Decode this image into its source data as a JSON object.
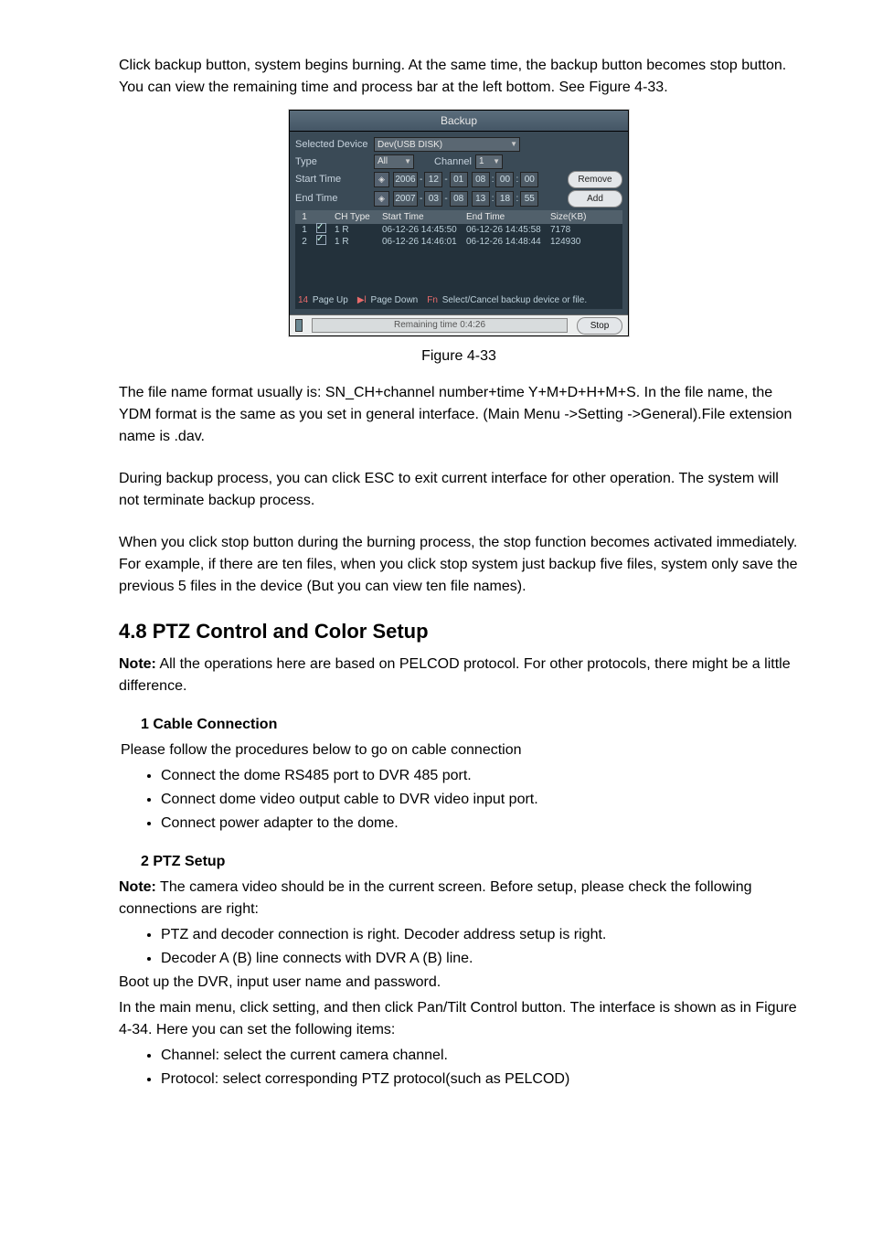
{
  "doc": {
    "p1": "Click backup button, system begins burning. At the same time, the backup button becomes stop button. You can view the remaining time and process bar at the left bottom. See Figure 4-33.",
    "fig_caption": "Figure 4-33",
    "p2": "The file name format usually is: SN_CH+channel number+time Y+M+D+H+M+S. In the file name, the YDM format is the same as you set in general interface. (Main Menu ->Setting ->General).File extension name is .dav.",
    "p3": "During backup process, you can click ESC to exit current interface for other operation. The system will not terminate backup process.",
    "p4": "When you click stop button during the burning process, the stop function becomes activated immediately. For example, if there are ten files, when you click stop system just backup five files, system only save the previous 5 files in the device (But you can view ten file names).",
    "sec48": "4.8  PTZ Control and Color Setup",
    "p5a": "Note:",
    "p5b": " All the operations here are based on PELCOD protocol. For other protocols, there might be a little difference.",
    "h_cable": "1 Cable Connection",
    "p_cable_intro": " Please follow the procedures below to go on cable connection",
    "cable_items": [
      "Connect the dome RS485 port to DVR 485 port.",
      "Connect dome video output cable to DVR video input port.",
      "Connect power adapter to the dome."
    ],
    "h_ptz": "2 PTZ Setup",
    "p_ptz_note_a": "Note:",
    "p_ptz_note_b": " The camera video should be in the current screen. Before setup, please check the following connections are right:",
    "ptz_check_items": [
      "PTZ and decoder connection is right. Decoder address setup is right.",
      "Decoder A (B) line connects with DVR A (B) line."
    ],
    "p_boot": "Boot up the DVR, input user name and password.",
    "p_mainmenu": "In the main menu, click setting, and then click Pan/Tilt Control button. The interface is shown as in Figure 4-34. Here you can set the following items:",
    "ptz_set_items": [
      "Channel: select the current camera channel.",
      "Protocol: select corresponding PTZ protocol(such as PELCOD)"
    ]
  },
  "dlg": {
    "title": "Backup",
    "labels": {
      "selected_device": "Selected Device",
      "type": "Type",
      "start_time": "Start Time",
      "end_time": "End Time",
      "channel": "Channel"
    },
    "device_value": "Dev(USB DISK)",
    "type_value": "All",
    "channel_value": "1",
    "start": {
      "y": "2006",
      "m": "12",
      "d": "01",
      "hh": "08",
      "mm": "00",
      "ss": "00"
    },
    "end": {
      "y": "2007",
      "m": "03",
      "d": "08",
      "hh": "13",
      "mm": "18",
      "ss": "55"
    },
    "buttons": {
      "remove": "Remove",
      "add": "Add",
      "stop": "Stop"
    },
    "columns": {
      "idx": "1",
      "ch_type": "CH Type",
      "start": "Start Time",
      "end": "End Time",
      "size": "Size(KB)"
    },
    "rows": [
      {
        "idx": "1",
        "ch": "1 R",
        "start": "06-12-26 14:45:50",
        "end": "06-12-26 14:45:58",
        "size": "7178"
      },
      {
        "idx": "2",
        "ch": "1 R",
        "start": "06-12-26 14:46:01",
        "end": "06-12-26 14:48:44",
        "size": "124930"
      }
    ],
    "foot": {
      "pageup_key": "14",
      "pageup": "Page Up",
      "pagedown_key": "▶l",
      "pagedown": "Page Down",
      "select_key": "Fn",
      "select_label": "Select/Cancel backup device or file."
    },
    "remaining": "Remaining time 0:4:26"
  }
}
